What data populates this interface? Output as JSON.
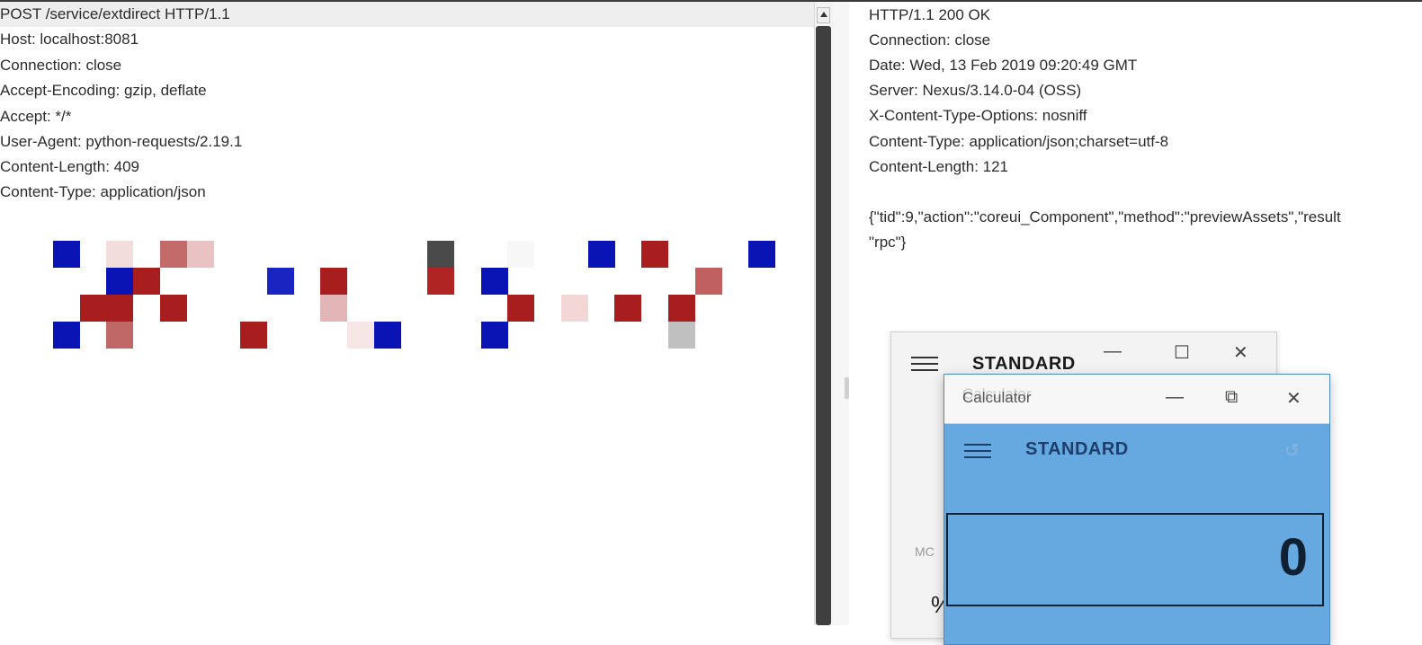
{
  "request": {
    "lines": [
      "POST /service/extdirect HTTP/1.1",
      "Host: localhost:8081",
      "Connection: close",
      "Accept-Encoding: gzip, deflate",
      "Accept: */*",
      "User-Agent: python-requests/2.19.1",
      "Content-Length: 409",
      "Content-Type: application/json"
    ]
  },
  "response": {
    "lines": [
      "HTTP/1.1 200 OK",
      "Connection: close",
      "Date: Wed, 13 Feb 2019 09:20:49 GMT",
      "Server: Nexus/3.14.0-04 (OSS)",
      "X-Content-Type-Options: nosniff",
      "Content-Type: application/json;charset=utf-8",
      "Content-Length: 121",
      "",
      "{\"tid\":9,\"action\":\"coreui_Component\",\"method\":\"previewAssets\",\"result",
      "\"rpc\"}"
    ]
  },
  "calculator_back": {
    "title": "STANDARD",
    "minimize": "—",
    "maximize": "☐",
    "close": "✕",
    "mc": "MC",
    "percent": "%"
  },
  "calculator_front": {
    "app_title": "Calculator",
    "mode_title": "STANDARD",
    "minimize": "—",
    "maximize": "⧉",
    "close": "✕",
    "history_icon": "↺",
    "display_value": "0"
  },
  "colors": {
    "accent_blue": "#65a9e0",
    "artifact_blue": "#0a14b4",
    "artifact_red": "#a81e1e"
  }
}
